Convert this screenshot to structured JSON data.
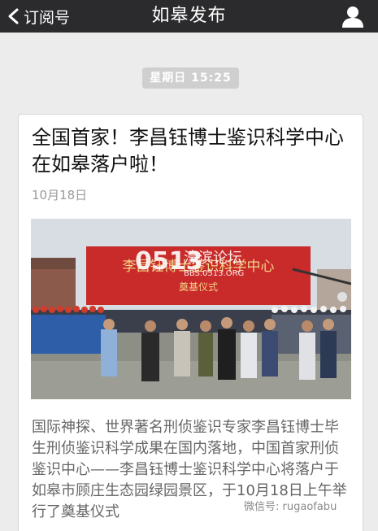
{
  "nav": {
    "back_label": "订阅号",
    "title": "如皋发布"
  },
  "time_badge": "星期日 15:25",
  "article": {
    "title": "全国首家！李昌钰博士鉴识科学中心在如皋落户啦！",
    "date": "10月18日",
    "image": {
      "banner_text": "李昌钰博士鉴识科学中心",
      "banner_subtext": "奠基仪式",
      "overlay_logo": "0513",
      "overlay_name": "濠滨论坛",
      "overlay_url": "BBS.0513.ORG"
    },
    "summary": "国际神探、世界著名刑侦鉴识专家李昌钰博士毕生刑侦鉴识科学成果在国内落地，中国首家刑侦鉴识中心——李昌钰博士鉴识科学中心将落户于如皋市顾庄生态园绿园景区，于10月18日上午举行了奠基仪式"
  },
  "watermark": "微信号: rugaofabu",
  "colors": {
    "topbar": "#2b2b2d",
    "background": "#ececec",
    "banner_red": "#c92a2a"
  },
  "icons": {
    "back": "chevron-left-icon",
    "user": "user-icon"
  }
}
